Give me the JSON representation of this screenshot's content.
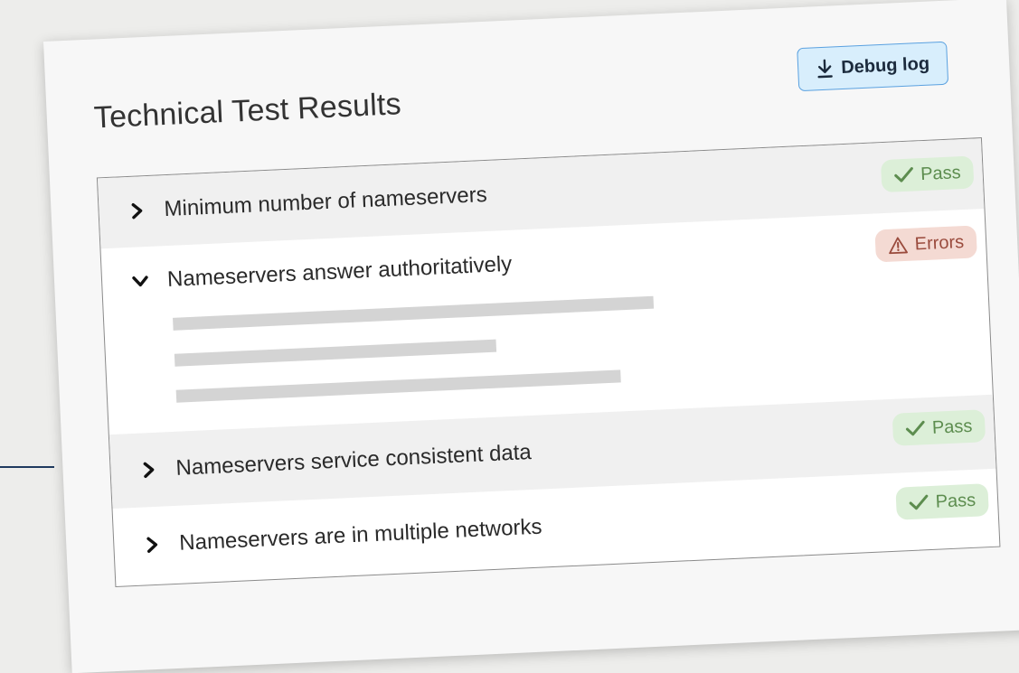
{
  "page": {
    "title": "Technical Test Results",
    "debug_button": {
      "label": "Debug log",
      "icon": "download-icon"
    }
  },
  "results": [
    {
      "label": "Minimum number of nameservers",
      "status": "Pass",
      "state": "collapsed",
      "icon": "check-icon"
    },
    {
      "label": "Nameservers answer authoritatively",
      "status": "Errors",
      "state": "expanded",
      "icon": "warning-icon"
    },
    {
      "label": "Nameservers service consistent data",
      "status": "Pass",
      "state": "collapsed",
      "icon": "check-icon"
    },
    {
      "label": "Nameservers are in multiple networks",
      "status": "Pass",
      "state": "collapsed",
      "icon": "check-icon"
    }
  ],
  "colors": {
    "pass_bg": "#dcefd8",
    "pass_fg": "#5d8d4f",
    "error_bg": "#f4dad3",
    "error_fg": "#9a4b3d",
    "button_bg": "#d8eefc",
    "button_border": "#5aa1e0"
  }
}
